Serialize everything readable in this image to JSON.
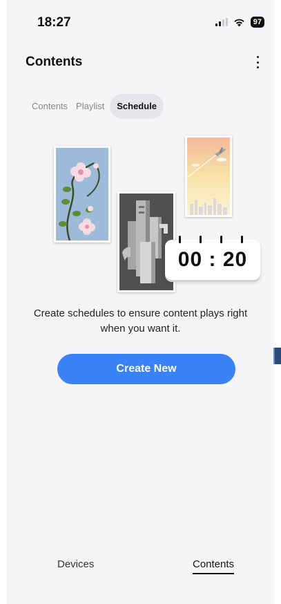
{
  "status_bar": {
    "time": "18:27",
    "battery": "97"
  },
  "header": {
    "title": "Contents"
  },
  "tabs": [
    {
      "label": "Contents",
      "active": false
    },
    {
      "label": "Playlist",
      "active": false
    },
    {
      "label": "Schedule",
      "active": true
    }
  ],
  "illustration": {
    "clock_text": "00 : 20"
  },
  "empty_state": {
    "message": "Create schedules to ensure content plays right when you want it.",
    "button_label": "Create New"
  },
  "bottom_nav": [
    {
      "label": "Devices",
      "active": false
    },
    {
      "label": "Contents",
      "active": true
    }
  ],
  "colors": {
    "accent": "#3b82f6",
    "background": "#f5f5f7"
  },
  "icons": [
    "signal-icon",
    "wifi-icon",
    "battery-icon",
    "more-vertical-icon"
  ]
}
